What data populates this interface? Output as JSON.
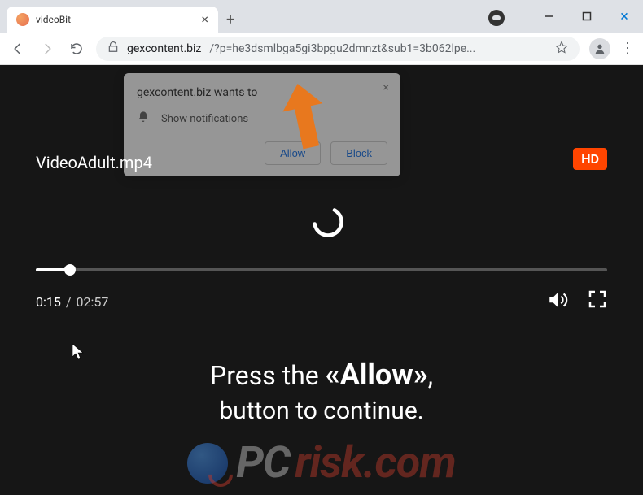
{
  "tab": {
    "title": "videoBit"
  },
  "address": {
    "domain": "gexcontent.biz",
    "path": "/?p=he3dsmlbga5gi3bpgu2dmnzt&sub1=3b062lpe..."
  },
  "notification": {
    "title": "gexcontent.biz wants to",
    "line": "Show notifications",
    "allow": "Allow",
    "block": "Block"
  },
  "video": {
    "title": "VideoAdult.mp4",
    "badge": "HD",
    "current": "0:15",
    "duration": "02:57"
  },
  "message": {
    "prefix": "Press the ",
    "allow": "«Allow»",
    "suffix": ",",
    "line2": "button to continue."
  },
  "watermark": {
    "part1": "PC",
    "part2": "risk.com"
  }
}
